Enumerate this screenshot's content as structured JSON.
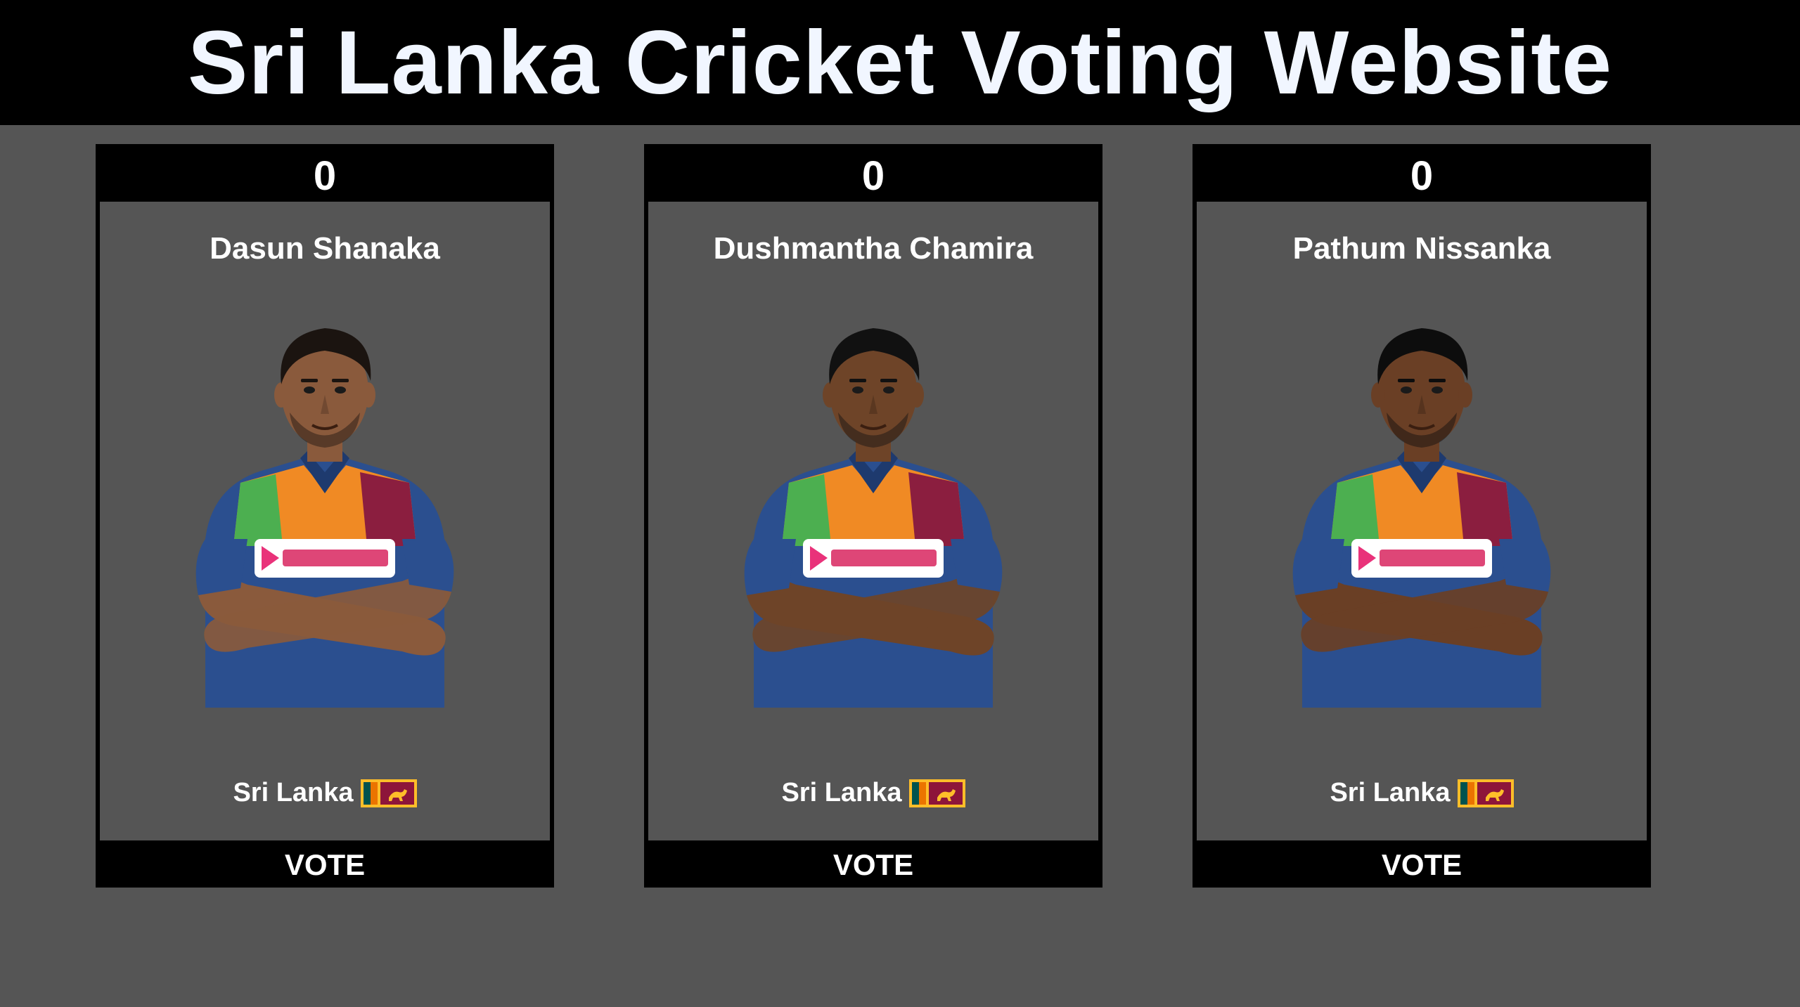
{
  "header": {
    "title": "Sri Lanka Cricket Voting Website"
  },
  "colors": {
    "background": "#555555",
    "header_bg": "#000000",
    "title_color": "#f1f6ff",
    "jersey_blue": "#2b4f8f",
    "jersey_orange": "#f08a24",
    "jersey_maroon": "#8b1e3f",
    "jersey_green": "#4caf50"
  },
  "players": [
    {
      "votes": "0",
      "name": "Dasun Shanaka",
      "country": "Sri Lanka",
      "flag_icon": "sri-lanka-flag-icon",
      "vote_label": "VOTE",
      "skin": "#8a5a3c",
      "hair": "#1b1410"
    },
    {
      "votes": "0",
      "name": "Dushmantha Chamira",
      "country": "Sri Lanka",
      "flag_icon": "sri-lanka-flag-icon",
      "vote_label": "VOTE",
      "skin": "#6e4428",
      "hair": "#111"
    },
    {
      "votes": "0",
      "name": "Pathum Nissanka",
      "country": "Sri Lanka",
      "flag_icon": "sri-lanka-flag-icon",
      "vote_label": "VOTE",
      "skin": "#6a3f25",
      "hair": "#0d0d0d"
    }
  ]
}
